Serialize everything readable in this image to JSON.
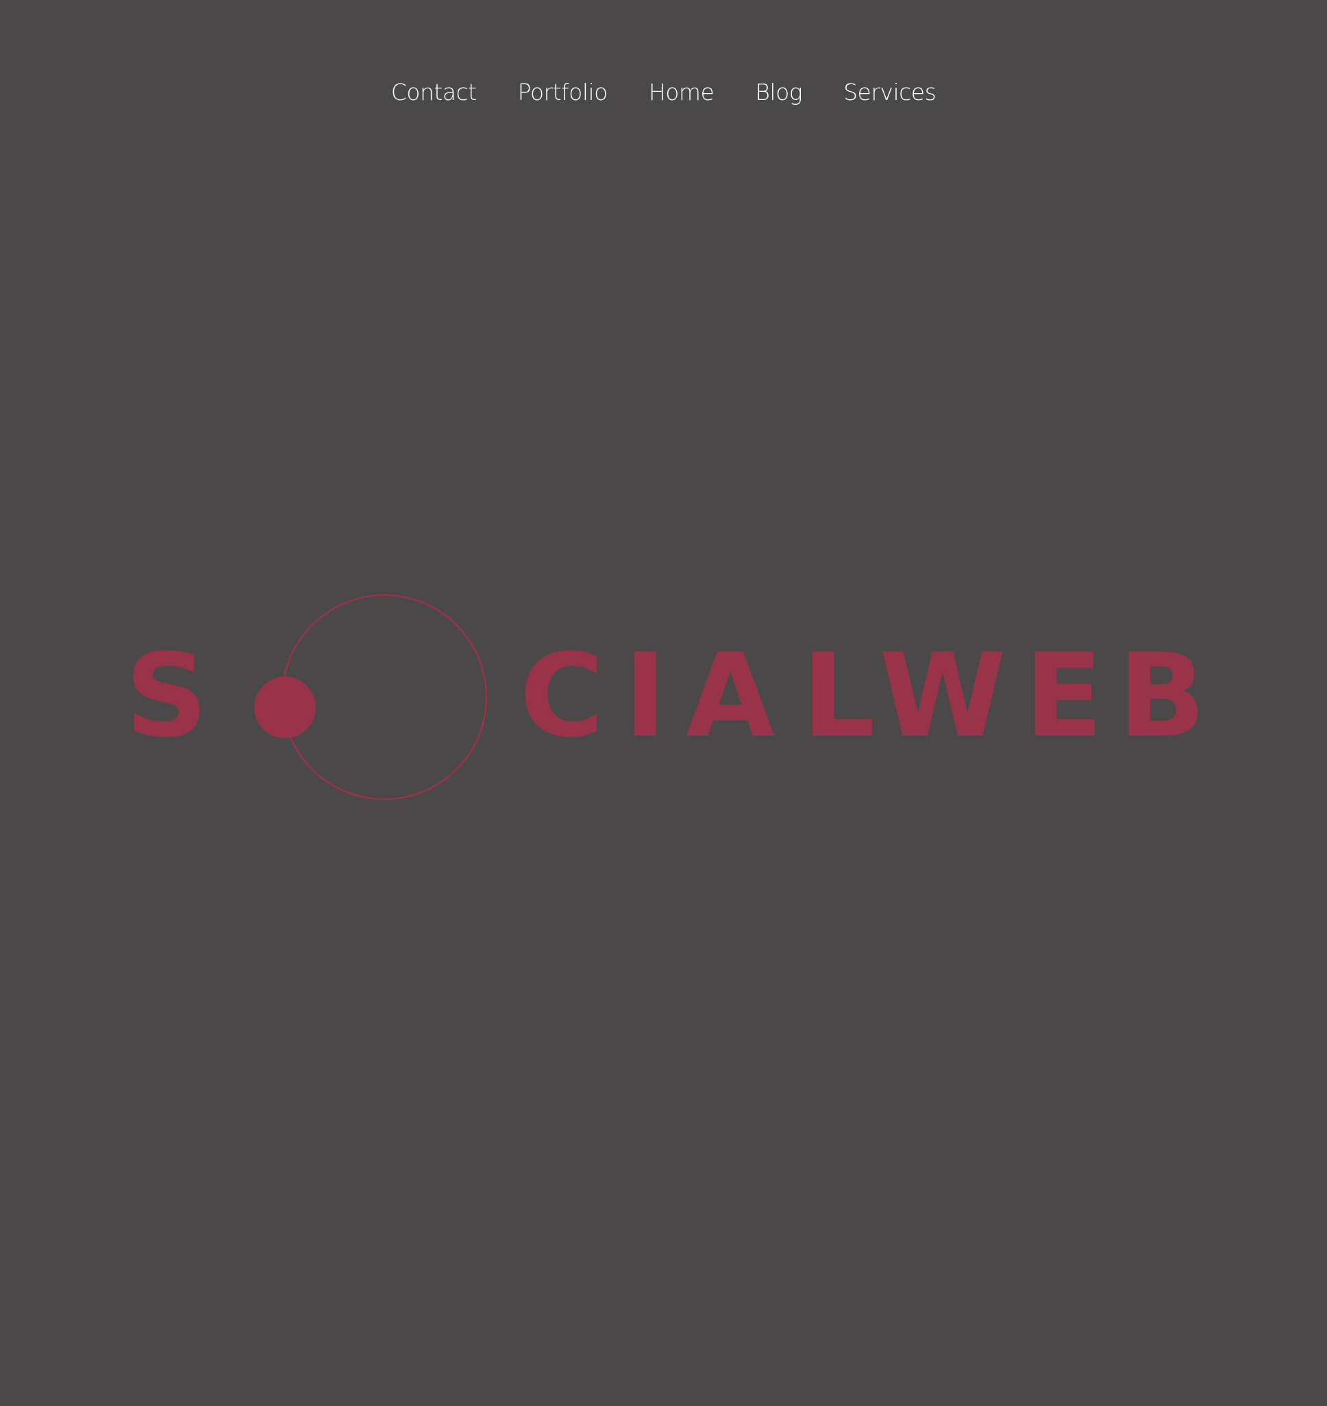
{
  "nav": {
    "items": [
      {
        "label": "Contact"
      },
      {
        "label": "Portfolio"
      },
      {
        "label": "Home"
      },
      {
        "label": "Blog"
      },
      {
        "label": "Services"
      }
    ]
  },
  "logo": {
    "letters": [
      "S",
      "C",
      "I",
      "A",
      "L",
      "W",
      "E",
      "B"
    ],
    "color": "#993349"
  },
  "colors": {
    "background": "#4a4849",
    "nav_text": "#ffffff",
    "accent": "#993349"
  }
}
